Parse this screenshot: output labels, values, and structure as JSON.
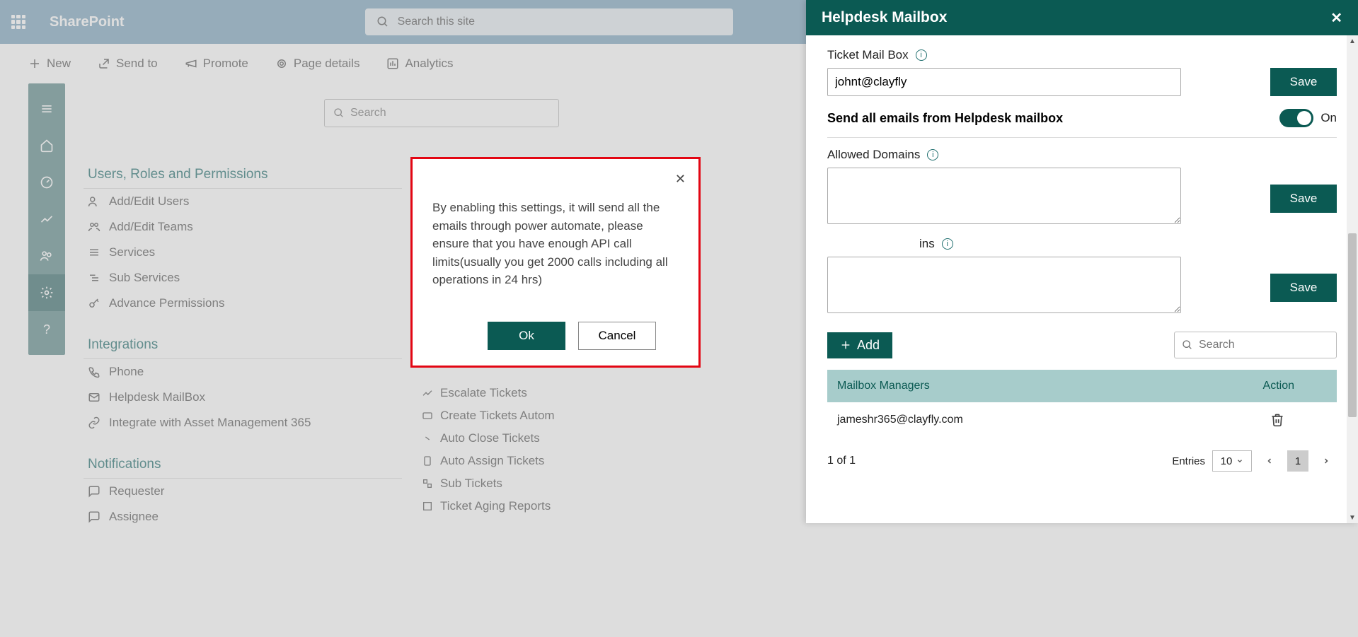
{
  "topbar": {
    "brand": "SharePoint",
    "search_placeholder": "Search this site"
  },
  "cmdbar": {
    "new": "New",
    "sendto": "Send to",
    "promote": "Promote",
    "pagedetails": "Page details",
    "analytics": "Analytics"
  },
  "minisearch": {
    "placeholder": "Search"
  },
  "sections": {
    "users": {
      "title": "Users, Roles and Permissions",
      "items": [
        "Add/Edit Users",
        "Add/Edit Teams",
        "Services",
        "Sub Services",
        "Advance Permissions"
      ]
    },
    "integrations": {
      "title": "Integrations",
      "items": [
        "Phone",
        "Helpdesk MailBox",
        "Integrate with Asset Management 365"
      ]
    },
    "notifications": {
      "title": "Notifications",
      "items": [
        "Requester",
        "Assignee"
      ]
    }
  },
  "midcol": {
    "items": [
      "Escalate Tickets",
      "Create Tickets Autom",
      "Auto Close Tickets",
      "Auto Assign Tickets",
      "Sub Tickets",
      "Ticket Aging Reports"
    ]
  },
  "panel": {
    "title": "Helpdesk Mailbox",
    "ticket_label": "Ticket Mail Box",
    "ticket_value": "johnt@clayfly",
    "save": "Save",
    "sendall_label": "Send all emails from Helpdesk mailbox",
    "on": "On",
    "allowed_label": "Allowed Domains",
    "excluded_label_tail": "ins",
    "add": "Add",
    "search_placeholder": "Search",
    "th_manager": "Mailbox Managers",
    "th_action": "Action",
    "row_email": "jameshr365@clayfly.com",
    "pager_summary": "1 of 1",
    "entries_label": "Entries",
    "entries_value": "10",
    "page_current": "1"
  },
  "modal": {
    "text": "By enabling this settings, it will send all the emails through power automate, please ensure that you have enough API call limits(usually you get 2000 calls including all operations in 24 hrs)",
    "ok": "Ok",
    "cancel": "Cancel"
  }
}
